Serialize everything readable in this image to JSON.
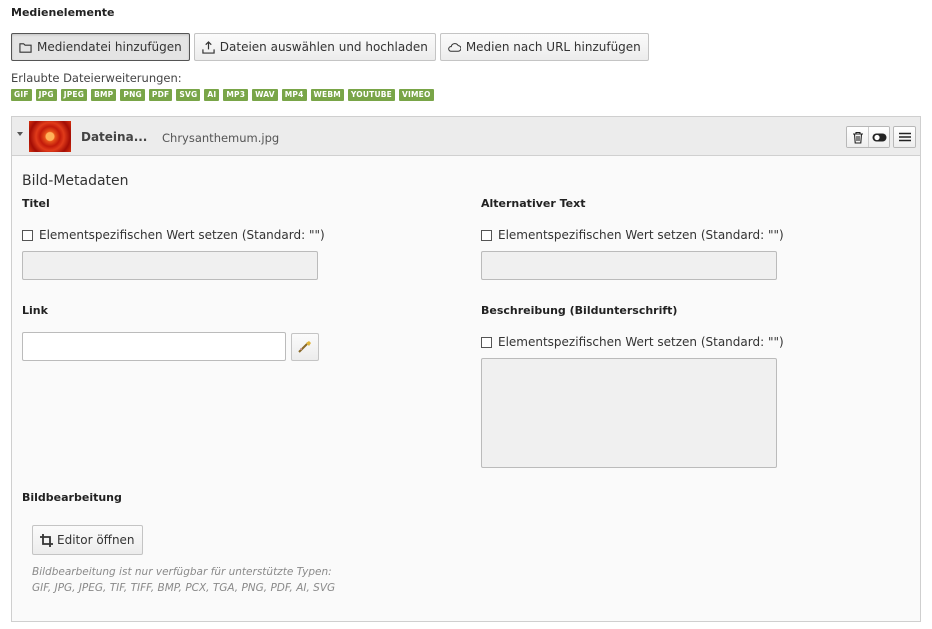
{
  "section_title": "Medienelemente",
  "buttons": {
    "add_media": "Mediendatei hinzufügen",
    "upload": "Dateien auswählen und hochladen",
    "add_url": "Medien nach URL hinzufügen"
  },
  "allowed_label": "Erlaubte Dateierweiterungen:",
  "extensions": [
    "GIF",
    "JPG",
    "JPEG",
    "BMP",
    "PNG",
    "PDF",
    "SVG",
    "AI",
    "MP3",
    "WAV",
    "MP4",
    "WEBM",
    "YOUTUBE",
    "VIMEO"
  ],
  "file": {
    "label": "Dateina...",
    "name": "Chrysanthemum.jpg"
  },
  "metadata": {
    "title": "Bild-Metadaten",
    "titel_label": "Titel",
    "alt_label": "Alternativer Text",
    "link_label": "Link",
    "desc_label": "Beschreibung (Bildunterschrift)",
    "override_text": "Elementspezifischen Wert setzen (Standard: \"\")"
  },
  "editing": {
    "label": "Bildbearbeitung",
    "button": "Editor öffnen",
    "hint_line1": "Bildbearbeitung ist nur verfügbar für unterstützte Typen:",
    "hint_line2": "GIF, JPG, JPEG, TIF, TIFF, BMP, PCX, TGA, PNG, PDF, AI, SVG"
  },
  "colors": {
    "ext_badge": "#79a548",
    "panel_header": "#ececec"
  }
}
